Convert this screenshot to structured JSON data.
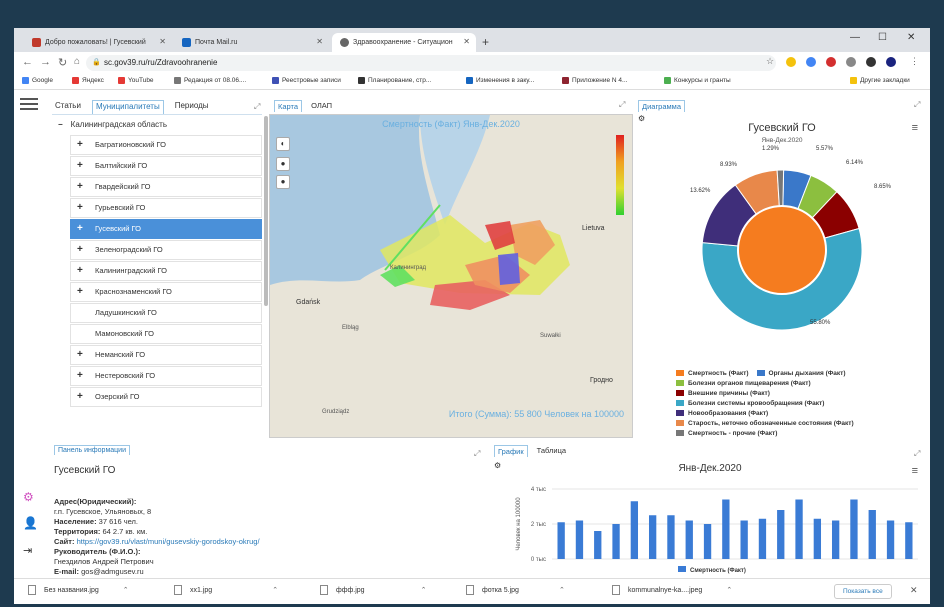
{
  "browser": {
    "tabs": [
      {
        "label": "Добро пожаловать! | Гусевский",
        "color": "#c0392b"
      },
      {
        "label": "Почта Mail.ru",
        "color": "#1565c0"
      },
      {
        "label": "Здравоохранение - Ситуацион",
        "color": "#555555"
      }
    ],
    "url": "sc.gov39.ru/ru/Zdravoohranenie",
    "bookmarks": [
      {
        "label": "Google",
        "color": "#4285f4"
      },
      {
        "label": "Яндекс",
        "color": "#e53935"
      },
      {
        "label": "YouTube",
        "color": "#e53935"
      },
      {
        "label": "Редакция от 08.06....",
        "color": "#777777"
      },
      {
        "label": "Реестровые записи",
        "color": "#3f51b5"
      },
      {
        "label": "Планирование, стр...",
        "color": "#333333"
      },
      {
        "label": "Изменения в заку...",
        "color": "#1565c0"
      },
      {
        "label": "Приложение N 4...",
        "color": "#8e2430"
      },
      {
        "label": "Конкурсы и гранты",
        "color": "#4caf50"
      }
    ],
    "other_bookmarks": "Другие закладки"
  },
  "panel_tabs": [
    "Статьи",
    "Муниципалитеты",
    "Периоды"
  ],
  "tree": {
    "root": "Калининградская область",
    "items": [
      {
        "label": "Багратионовский ГО",
        "plus": true,
        "selected": false
      },
      {
        "label": "Балтийский ГО",
        "plus": true,
        "selected": false
      },
      {
        "label": "Гвардейский ГО",
        "plus": true,
        "selected": false
      },
      {
        "label": "Гурьевский ГО",
        "plus": true,
        "selected": false
      },
      {
        "label": "Гусевский ГО",
        "plus": true,
        "selected": true
      },
      {
        "label": "Зеленоградский ГО",
        "plus": true,
        "selected": false
      },
      {
        "label": "Калининградский ГО",
        "plus": true,
        "selected": false
      },
      {
        "label": "Краснознаменский ГО",
        "plus": true,
        "selected": false
      },
      {
        "label": "Ладушкинский ГО",
        "plus": false,
        "selected": false
      },
      {
        "label": "Мамоновский ГО",
        "plus": false,
        "selected": false
      },
      {
        "label": "Неманский ГО",
        "plus": true,
        "selected": false
      },
      {
        "label": "Нестеровский ГО",
        "plus": true,
        "selected": false
      },
      {
        "label": "Озерский ГО",
        "plus": true,
        "selected": false
      }
    ]
  },
  "map": {
    "tabs": [
      "Карта",
      "ОЛАП"
    ],
    "title": "Смертность (Факт) Янв-Дек.2020",
    "total": "Итого (Сумма): 55 800 Человек на 100000",
    "place_labels": [
      "Калининград",
      "Gdańsk",
      "Lietuva",
      "Suwałki",
      "Гродно",
      "Elbląg",
      "Grudziądz"
    ]
  },
  "diagram": {
    "tab": "Диаграмма",
    "title": "Гусевский ГО",
    "subtitle": "Янв-Дек.2020",
    "slices": [
      {
        "label": "Смертность (Факт)",
        "pct": 0,
        "color": "#f57c1f"
      },
      {
        "label": "Органы дыхания (Факт)",
        "pct": 5.57,
        "color": "#3a78c9"
      },
      {
        "label": "Болезни органов пищеварения (Факт)",
        "pct": 6.14,
        "color": "#8cbf3f"
      },
      {
        "label": "Внешние причины (Факт)",
        "pct": 8.65,
        "color": "#8b0000"
      },
      {
        "label": "Болезни системы кровообращения (Факт)",
        "pct": 55.8,
        "color": "#3aa7c6"
      },
      {
        "label": "Новообразования (Факт)",
        "pct": 13.62,
        "color": "#3f2e7a"
      },
      {
        "label": "Старость, неточно обозначенные состояния (Факт)",
        "pct": 8.93,
        "color": "#e8884a"
      },
      {
        "label": "Смертность - прочие (Факт)",
        "pct": 1.29,
        "color": "#777777"
      }
    ],
    "pct_labels": [
      "1.29%",
      "5.57%",
      "6.14%",
      "8.65%",
      "55.80%",
      "13.62%",
      "8.93%"
    ]
  },
  "info": {
    "tab": "Панель информации",
    "title": "Гусевский ГО",
    "address_label": "Адрес(Юридический):",
    "address": "г.п. Гусевское, Ульяновых, 8",
    "population_label": "Население:",
    "population": "37 616 чел.",
    "territory_label": "Территория:",
    "territory": "64 2.7 кв. км.",
    "site_label": "Сайт:",
    "site": "https://gov39.ru/vlast/muni/gusevskiy-gorodskoy-okrug/",
    "head_label": "Руководитель (Ф.И.О.):",
    "head": "Гнездилов Андрей Петрович",
    "email_label": "E-mail:",
    "email": "gos@admgusev.ru"
  },
  "chart_tabs": [
    "График",
    "Таблица"
  ],
  "chart_data": {
    "type": "bar",
    "title": "Янв-Дек.2020",
    "ylabel": "Человек на 100000",
    "yticks": [
      "0 тыс",
      "2 тыс",
      "4 тыс"
    ],
    "ylim": [
      0,
      4000
    ],
    "legend": "Смертность (Факт)",
    "color": "#3a7bd5",
    "values": [
      2100,
      2200,
      1600,
      2000,
      3300,
      2500,
      2500,
      2200,
      2000,
      3400,
      2200,
      2300,
      2800,
      3400,
      2300,
      2200,
      3400,
      2800,
      2200,
      2100
    ]
  },
  "downloads": {
    "items": [
      "Без названия.jpg",
      "xx1.jpg",
      "ффф.jpg",
      "фотка 5.jpg",
      "kommunalnye-ka....jpeg"
    ],
    "show_all": "Показать все"
  }
}
